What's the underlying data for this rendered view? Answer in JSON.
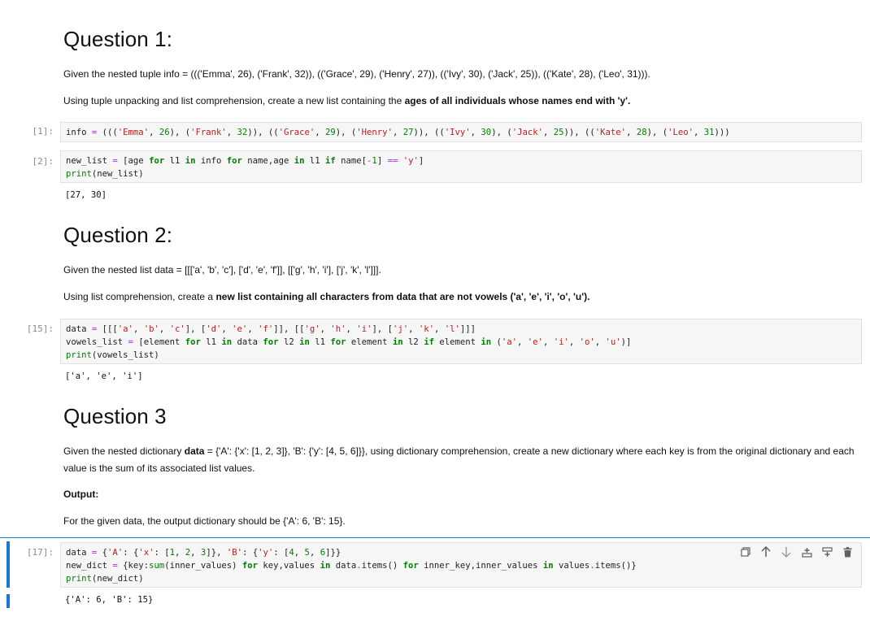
{
  "q1": {
    "heading": "Question 1:",
    "para1": "Given the nested tuple info = ((('Emma', 26), ('Frank', 32)), (('Grace', 29), ('Henry', 27)), (('Ivy', 30), ('Jack', 25)), (('Kate', 28), ('Leo', 31))).",
    "para2_pre": "Using tuple unpacking and list comprehension, create a new list containing the ",
    "para2_bold": "ages of all individuals whose names end with 'y'.",
    "cell1_prompt": "[1]:",
    "cell2_prompt": "[2]:",
    "cell2_output": "[27, 30]"
  },
  "q2": {
    "heading": "Question 2:",
    "para1": "Given the nested list data = [[['a', 'b', 'c'], ['d', 'e', 'f']], [['g', 'h', 'i'], ['j', 'k', 'l']]].",
    "para2_pre": "Using list comprehension, create a ",
    "para2_bold": "new list containing all characters from data that are not vowels ('a', 'e', 'i', 'o', 'u').",
    "cell_prompt": "[15]:",
    "cell_output": "['a', 'e', 'i']"
  },
  "q3": {
    "heading": "Question 3",
    "para1_pre": "Given the nested dictionary ",
    "para1_bold": "data",
    "para1_post": " = {'A': {'x': [1, 2, 3]}, 'B': {'y': [4, 5, 6]}}, using dictionary comprehension, create a new dictionary where each key is from the original dictionary and each value is the sum of its associated list values.",
    "output_label": "Output:",
    "para2": "For the given data, the output dictionary should be {'A': 6, 'B': 15}.",
    "cell_prompt": "[17]:",
    "cell_output": "{'A': 6, 'B': 15}"
  },
  "toolbar": {
    "icons": [
      "duplicate-icon",
      "move-up-icon",
      "move-down-icon",
      "insert-above-icon",
      "insert-below-icon",
      "delete-icon"
    ]
  },
  "colors": {
    "active": "#1976d2",
    "keyword": "#008000",
    "string": "#ba2121",
    "operator": "#aa22ff"
  }
}
